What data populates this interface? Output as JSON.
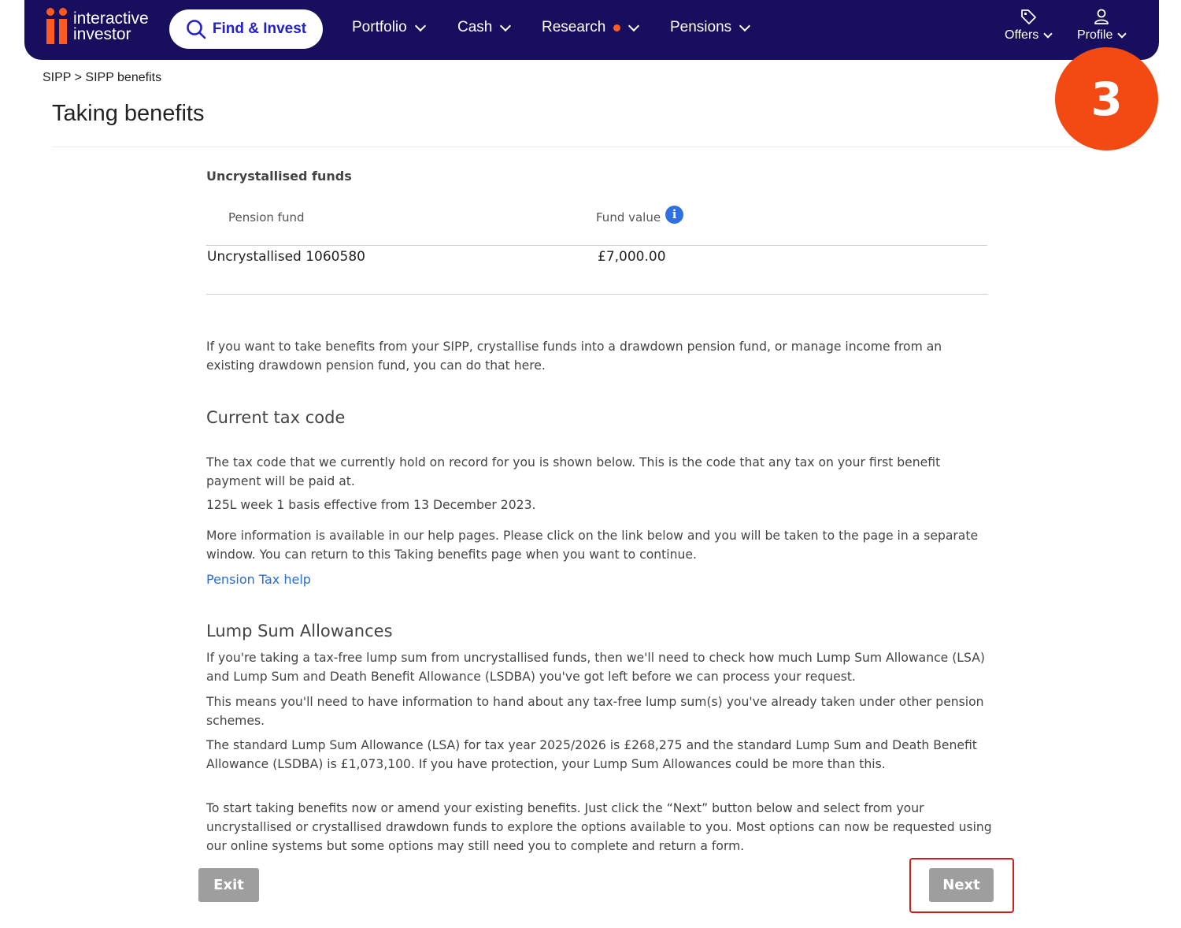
{
  "nav": {
    "logo_line1": "interactive",
    "logo_line2": "investor",
    "find_invest": "Find & Invest",
    "portfolio": "Portfolio",
    "cash": "Cash",
    "research": "Research",
    "pensions": "Pensions",
    "offers": "Offers",
    "profile": "Profile",
    "brand_color": "#170f5e",
    "accent_color": "#f24a12"
  },
  "breadcrumb": "SIPP > SIPP benefits",
  "page_title": "Taking benefits",
  "step_badge": "3",
  "funds": {
    "section_title": "Uncrystallised funds",
    "col_pension_fund": "Pension fund",
    "col_fund_value": "Fund value",
    "rows": [
      {
        "name": "Uncrystallised 1060580",
        "value": "£7,000.00"
      }
    ]
  },
  "intro": "If you want to take benefits from your SIPP, crystallise funds into a drawdown pension fund, or manage income from an existing drawdown pension fund, you can do that here.",
  "tax": {
    "heading": "Current tax code",
    "p1": "The tax code that we currently hold on record for you is shown below. This is the code that any tax on your first benefit payment will be paid at.",
    "p2": "125L week 1 basis effective from 13 December 2023.",
    "p3": "More information is available in our help pages. Please click on the link below and you will be taken to the page in a separate window. You can return to this Taking benefits page when you want to continue.",
    "link": "Pension Tax help"
  },
  "lsa": {
    "heading": "Lump Sum Allowances",
    "p1": "If you're taking a tax-free lump sum from uncrystallised funds, then we'll need to check how much Lump Sum Allowance (LSA) and Lump Sum and Death Benefit Allowance (LSDBA) you've got left before we can process your request.",
    "p2": "This means you'll need to have information to hand about any tax-free lump sum(s) you've already taken under other pension schemes.",
    "p3": "The standard Lump Sum Allowance (LSA) for tax year 2025/2026 is £268,275 and the standard Lump Sum and Death Benefit Allowance (LSDBA) is £1,073,100. If you have protection, your Lump Sum Allowances could be more than this."
  },
  "closing": "To start taking benefits now or amend your existing benefits. Just click the “Next” button below and select from your uncrystallised or crystallised drawdown funds to explore the options available to you. Most options can now be requested using our online systems but some options may still need you to complete and return a form.",
  "buttons": {
    "exit": "Exit",
    "next": "Next"
  }
}
